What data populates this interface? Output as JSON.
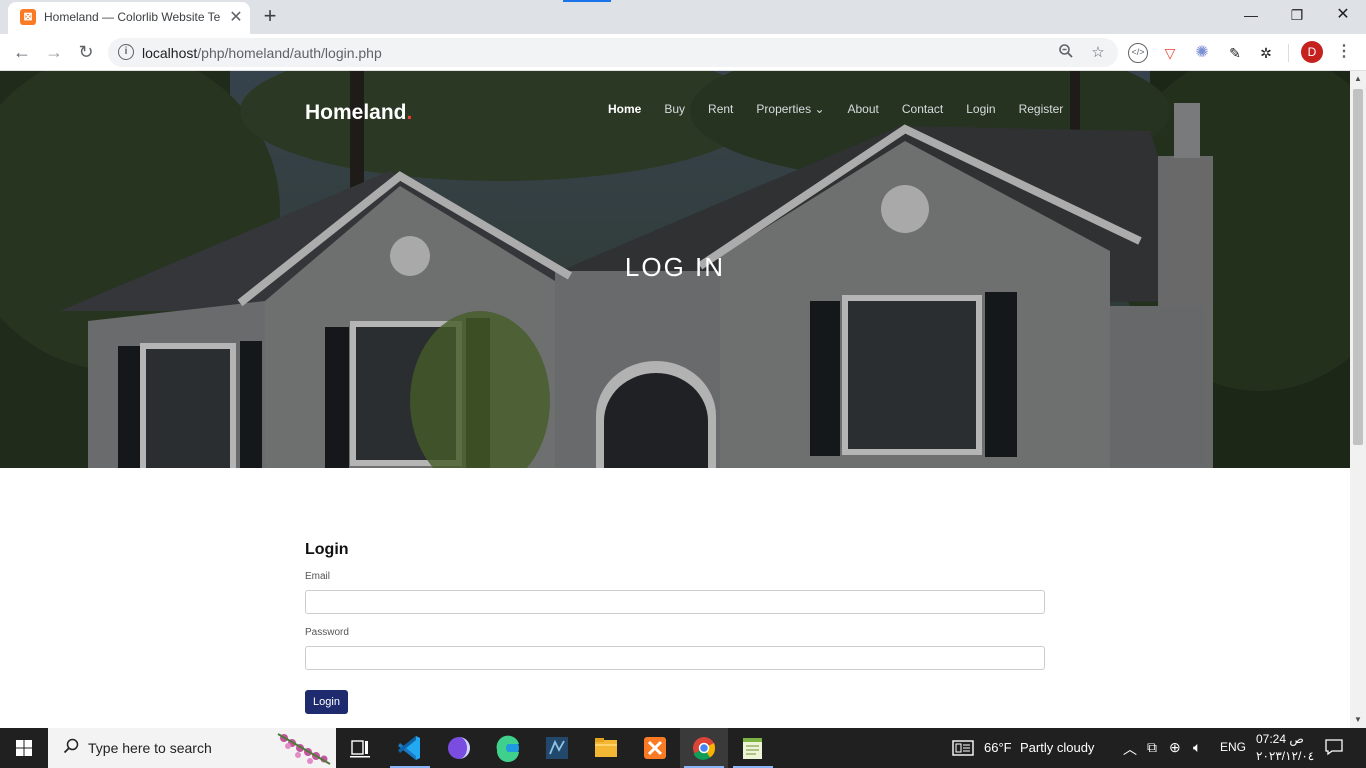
{
  "browser": {
    "tab_title": "Homeland — Colorlib Website Te",
    "tab_favicon_glyph": "⊠",
    "url_prefix": "localhost",
    "url_path": "/php/homeland/auth/login.php",
    "avatar_letter": "D"
  },
  "site": {
    "logo_text": "Homeland",
    "logo_dot": ".",
    "nav": [
      "Home",
      "Buy",
      "Rent",
      "Properties",
      "About",
      "Contact",
      "Login",
      "Register"
    ],
    "nav_dropdown_caret": "⌄",
    "hero_title": "LOG IN"
  },
  "login_form": {
    "heading": "Login",
    "email_label": "Email",
    "password_label": "Password",
    "submit_label": "Login"
  },
  "taskbar": {
    "search_placeholder": "Type here to search",
    "weather_temp": "66°F",
    "weather_text": "Partly cloudy",
    "language": "ENG",
    "time": "07:24 ص",
    "date": "٢٠٢٣/١٢/٠٤"
  },
  "colors": {
    "accent": "#1e2c6f",
    "logo_dot": "#f23a2e",
    "tab_favicon": "#fb7a24",
    "avatar": "#c5221f"
  }
}
